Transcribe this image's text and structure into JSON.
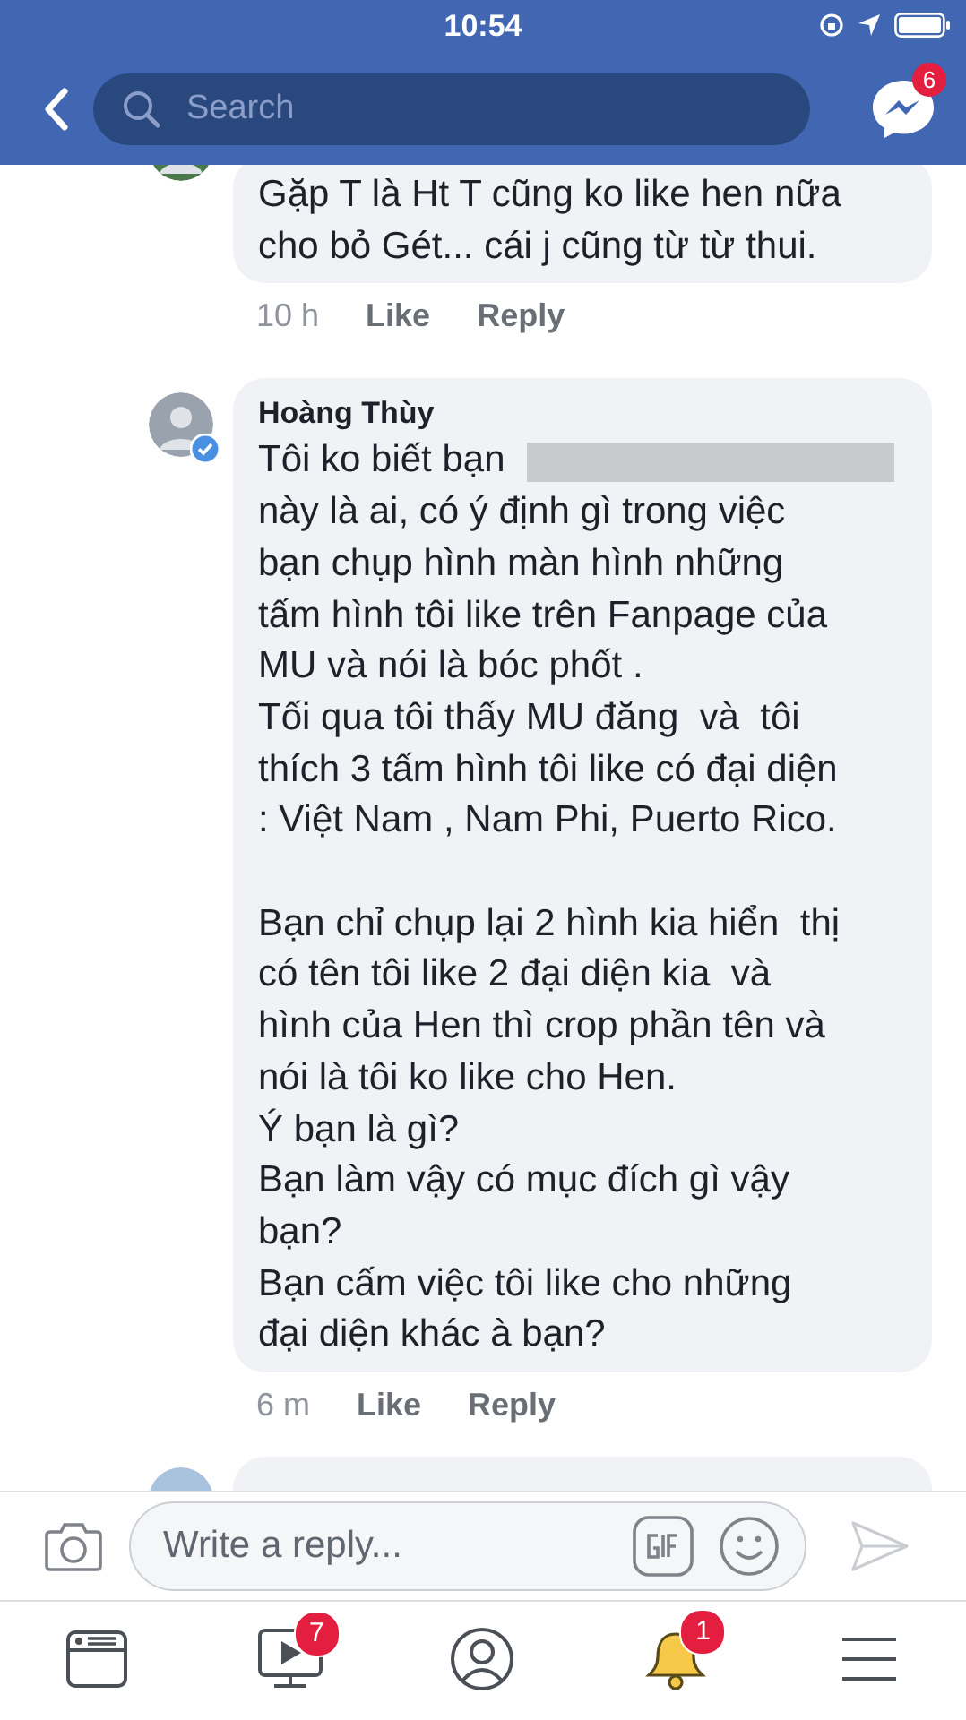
{
  "status_bar": {
    "time": "10:54"
  },
  "header": {
    "search": {
      "placeholder": "Search"
    },
    "messenger_badge": "6"
  },
  "comments": [
    {
      "paragraphs": [
        {
          "text": "Gặp T là Ht T cũng ko like hen nữa\ncho bỏ Gét... cái j cũng từ từ thui.",
          "redacted": false
        }
      ],
      "time": "10 h",
      "actions": [
        "Like",
        "Reply"
      ]
    },
    {
      "author": "Hoàng Thùy",
      "paragraphs": [
        {
          "text": "Tôi ko biết bạn\nnày là ai, có ý định gì trong việc\nbạn chụp hình màn hình những\ntấm hình tôi like trên Fanpage của\nMU và nói là bóc phốt .\nTối qua tôi thấy MU đăng  và  tôi\nthích 3 tấm hình tôi like có đại diện\n: Việt Nam , Nam Phi, Puerto Rico.",
          "redacted": true
        },
        {
          "text": "Bạn chỉ chụp lại 2 hình kia hiển  thị\ncó tên tôi like 2 đại diện kia  và\nhình của Hen thì crop phần tên và\nnói là tôi ko like cho Hen.\nÝ bạn là gì?\nBạn làm vậy có mục đích gì vậy\nbạn?\nBạn cấm việc tôi like cho những\nđại diện khác à bạn?",
          "redacted": false
        }
      ],
      "time": "6 m",
      "actions": [
        "Like",
        "Reply"
      ],
      "verified": true
    }
  ],
  "composer": {
    "placeholder": "Write a reply..."
  },
  "tab_bar": [
    {
      "kind": "news"
    },
    {
      "kind": "watch",
      "badge": "7"
    },
    {
      "kind": "profile"
    },
    {
      "kind": "notifications",
      "badge": "1"
    },
    {
      "kind": "menu"
    }
  ]
}
